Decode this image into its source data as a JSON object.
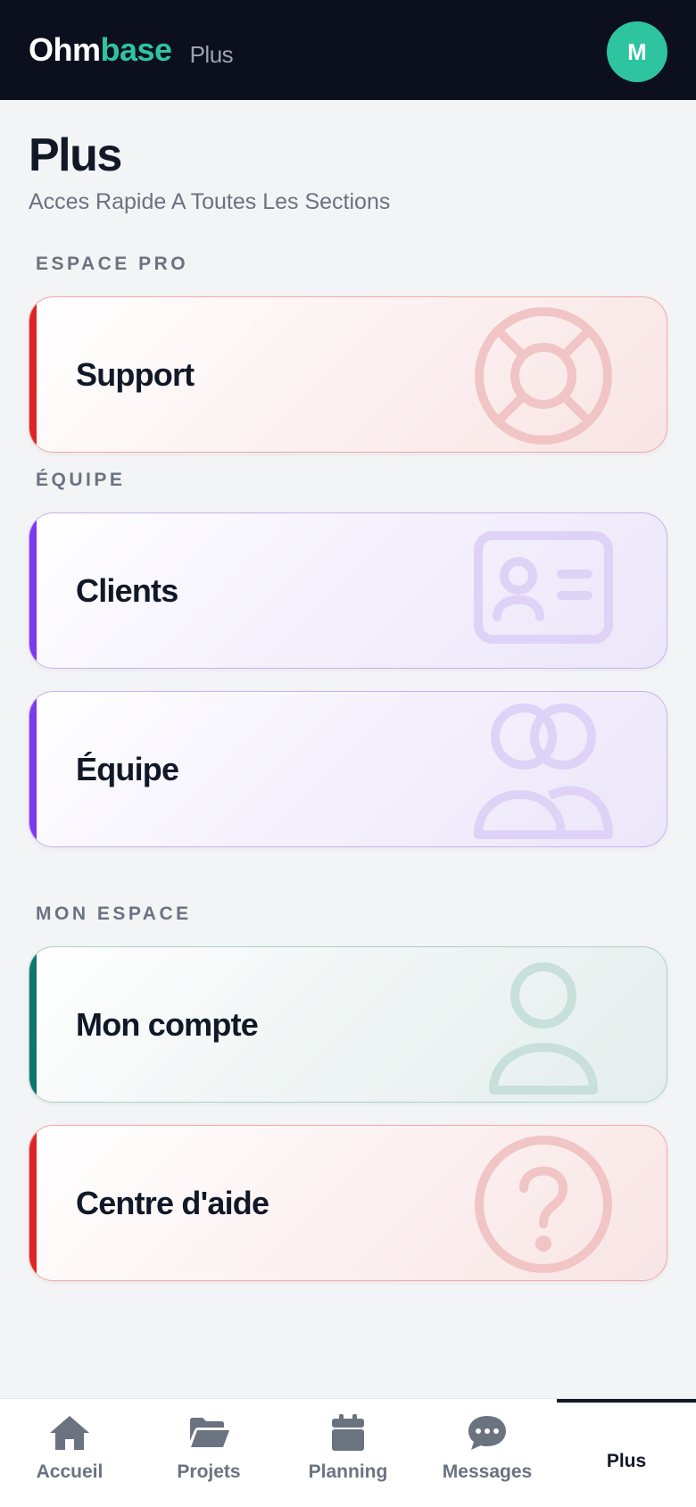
{
  "header": {
    "brand_part1": "Ohm",
    "brand_part2": "base",
    "page_name": "Plus",
    "avatar_initial": "M",
    "brand_color": "#2ec4a0",
    "background": "#0b0f1e"
  },
  "page": {
    "title": "Plus",
    "subtitle": "Acces Rapide A Toutes Les Sections"
  },
  "sections": [
    {
      "label": "ESPACE PRO",
      "items": [
        {
          "label": "Support",
          "icon": "lifebuoy-icon",
          "color": "#dc2626"
        }
      ]
    },
    {
      "label": "ÉQUIPE",
      "items": [
        {
          "label": "Clients",
          "icon": "id-card-icon",
          "color": "#7c3aed"
        },
        {
          "label": "Équipe",
          "icon": "users-icon",
          "color": "#7c3aed"
        }
      ]
    },
    {
      "label": "MON ESPACE",
      "items": [
        {
          "label": "Mon compte",
          "icon": "user-icon",
          "color": "#0f766e"
        },
        {
          "label": "Centre d'aide",
          "icon": "question-circle-icon",
          "color": "#dc2626"
        }
      ]
    }
  ],
  "bottom_nav": {
    "items": [
      {
        "label": "Accueil",
        "icon": "home-icon"
      },
      {
        "label": "Projets",
        "icon": "folder-open-icon"
      },
      {
        "label": "Planning",
        "icon": "calendar-icon"
      },
      {
        "label": "Messages",
        "icon": "chat-bubble-icon"
      },
      {
        "label": "Plus",
        "active": true
      }
    ]
  }
}
